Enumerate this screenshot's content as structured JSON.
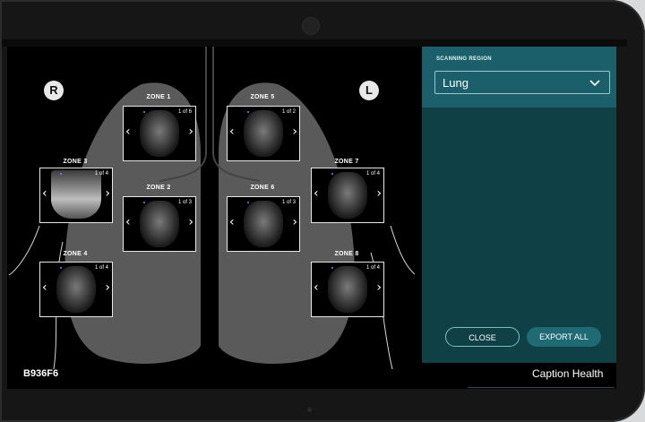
{
  "sides": {
    "right": "R",
    "left": "L"
  },
  "zones": [
    {
      "title": "ZONE 1",
      "count": "1 of 6"
    },
    {
      "title": "ZONE 2",
      "count": "1 of 3"
    },
    {
      "title": "ZONE 3",
      "count": "1 of 4"
    },
    {
      "title": "ZONE 4",
      "count": "1 of 4"
    },
    {
      "title": "ZONE 5",
      "count": "1 of 2"
    },
    {
      "title": "ZONE 6",
      "count": "1 of 3"
    },
    {
      "title": "ZONE 7",
      "count": "1 of 4"
    },
    {
      "title": "ZONE 8",
      "count": "1 of 4"
    }
  ],
  "panel": {
    "label": "SCANNING REGION",
    "selected": "Lung",
    "close_label": "CLOSE",
    "export_label": "EXPORT ALL"
  },
  "footer": {
    "device_id": "B936F6",
    "brand": "Caption Health"
  },
  "colors": {
    "panel_bg": "#0e4046",
    "panel_header": "#1a5f69",
    "accent": "#1f6b73",
    "lung_fill": "#5a5a5a"
  },
  "icons": [
    "chevron-left-icon",
    "chevron-right-icon",
    "chevron-down-icon"
  ]
}
